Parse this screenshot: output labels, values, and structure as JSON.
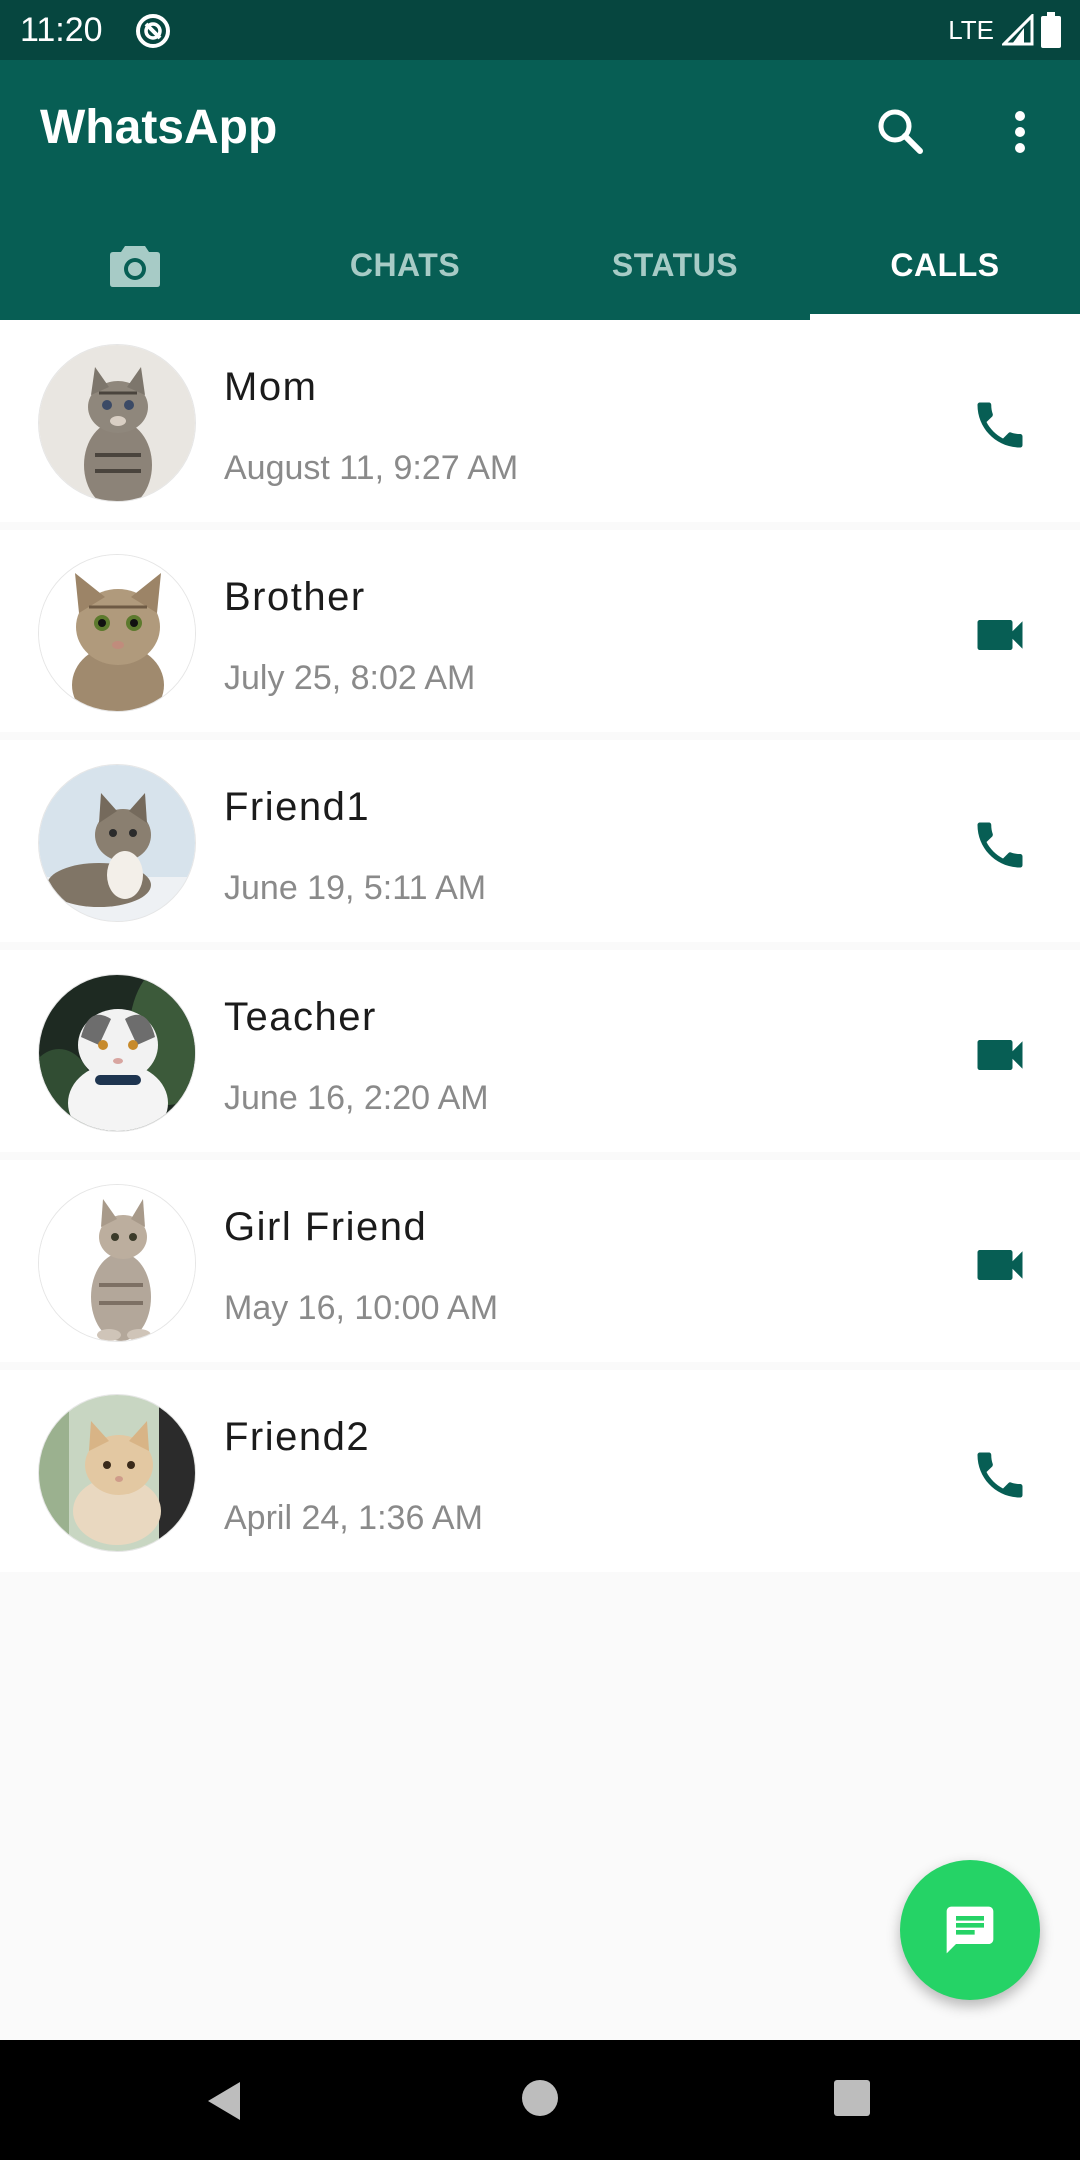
{
  "status_bar": {
    "time": "11:20",
    "network": "LTE",
    "icons": [
      "sync-icon",
      "signal-icon",
      "battery-icon"
    ]
  },
  "app_bar": {
    "title": "WhatsApp",
    "actions": [
      "search-icon",
      "more-vert-icon"
    ]
  },
  "tabs": [
    {
      "label": "",
      "icon": "camera-icon",
      "active": false
    },
    {
      "label": "CHATS",
      "active": false
    },
    {
      "label": "STATUS",
      "active": false
    },
    {
      "label": "CALLS",
      "active": true
    }
  ],
  "calls": [
    {
      "name": "Mom",
      "time": "August 11, 9:27 AM",
      "type": "voice",
      "action_icon": "phone-icon"
    },
    {
      "name": "Brother",
      "time": "July 25, 8:02 AM",
      "type": "video",
      "action_icon": "videocam-icon"
    },
    {
      "name": "Friend1",
      "time": "June 19, 5:11 AM",
      "type": "voice",
      "action_icon": "phone-icon"
    },
    {
      "name": "Teacher",
      "time": "June 16, 2:20 AM",
      "type": "video",
      "action_icon": "videocam-icon"
    },
    {
      "name": "Girl Friend",
      "time": "May 16, 10:00 AM",
      "type": "video",
      "action_icon": "videocam-icon"
    },
    {
      "name": "Friend2",
      "time": "April 24, 1:36 AM",
      "type": "voice",
      "action_icon": "phone-icon"
    }
  ],
  "fab": {
    "icon": "chat-icon"
  },
  "nav_bar": {
    "icons": [
      "back-icon",
      "home-icon",
      "recents-icon"
    ]
  },
  "colors": {
    "status_bar": "#06463f",
    "primary": "#075e54",
    "accent": "#25d366",
    "icon": "#075e54"
  }
}
